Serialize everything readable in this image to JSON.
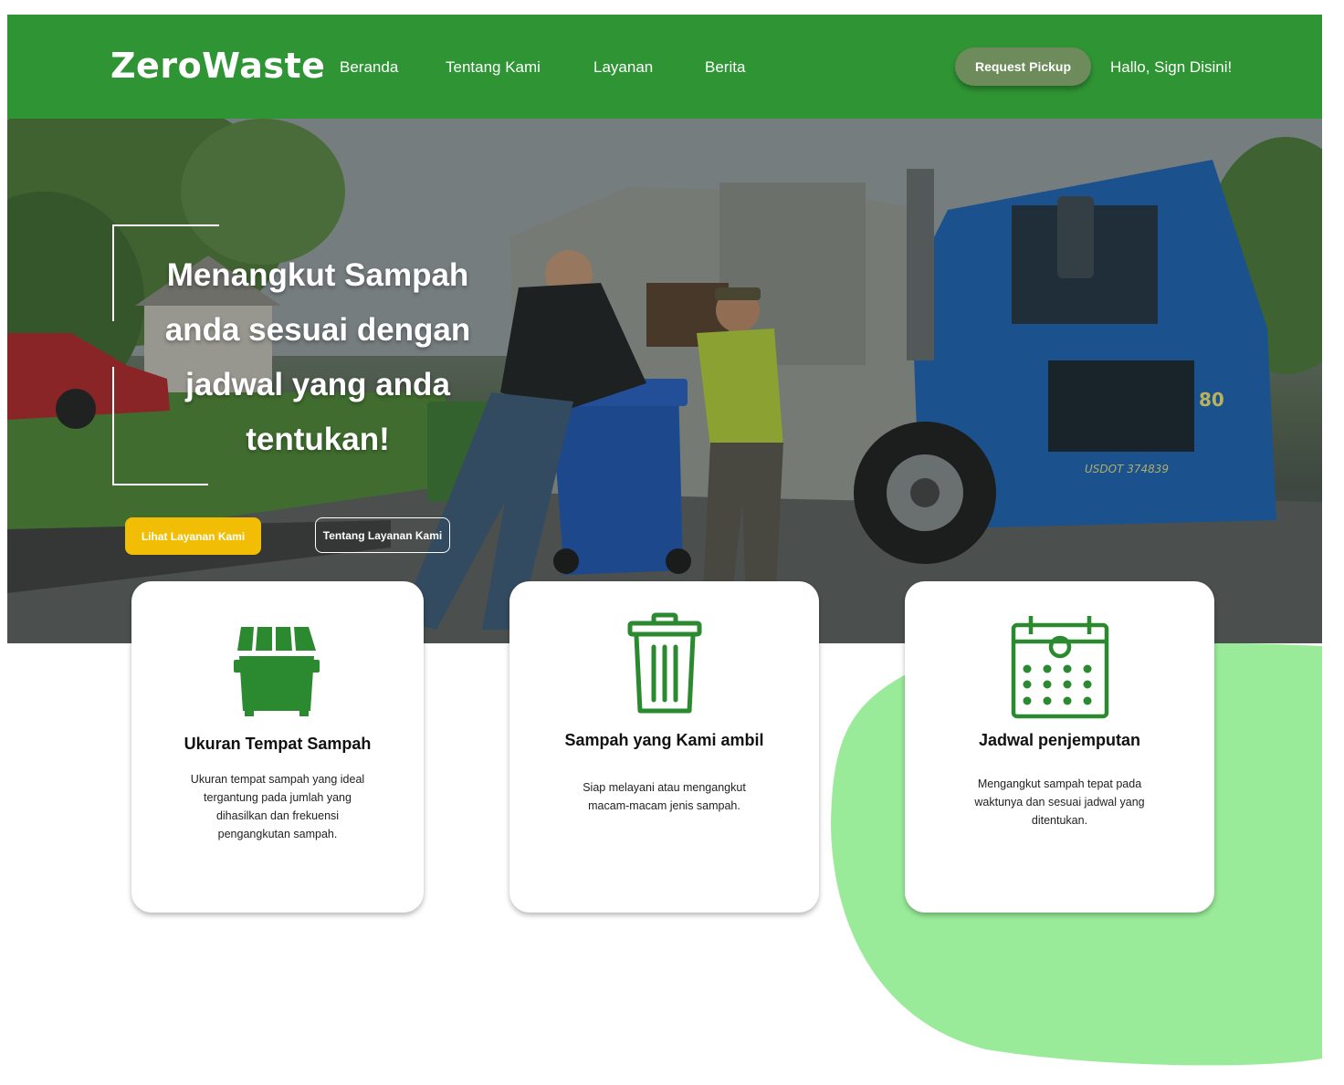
{
  "nav": {
    "logo": "ZeroWaste",
    "links": [
      "Beranda",
      "Tentang Kami",
      "Layanan",
      "Berita"
    ],
    "pickup_label": "Request Pickup",
    "signin_label": "Hallo, Sign Disini!"
  },
  "hero": {
    "title": "Menangkut Sampah anda sesuai dengan jadwal yang anda tentukan!",
    "primary_button": "Lihat Layanan Kami",
    "secondary_button": "Tentang Layanan Kami",
    "truck_plate": "USDOT 374839",
    "truck_number": "80"
  },
  "cards": [
    {
      "icon": "dumpster-icon",
      "title": "Ukuran Tempat Sampah",
      "description": "Ukuran tempat sampah yang ideal tergantung pada jumlah yang dihasilkan dan frekuensi pengangkutan sampah."
    },
    {
      "icon": "trash-can-icon",
      "title": "Sampah yang Kami ambil",
      "description": "Siap melayani atau mengangkut macam-macam jenis sampah."
    },
    {
      "icon": "calendar-icon",
      "title": "Jadwal penjemputan",
      "description": "Mengangkut sampah tepat pada waktunya dan sesuai jadwal yang ditentukan."
    }
  ],
  "colors": {
    "brand_green": "#2f9434",
    "pickup_button": "#6d8b5b",
    "cta_yellow": "#f2be05",
    "blob_green": "#99eb99",
    "icon_green": "#2b8a2f"
  }
}
